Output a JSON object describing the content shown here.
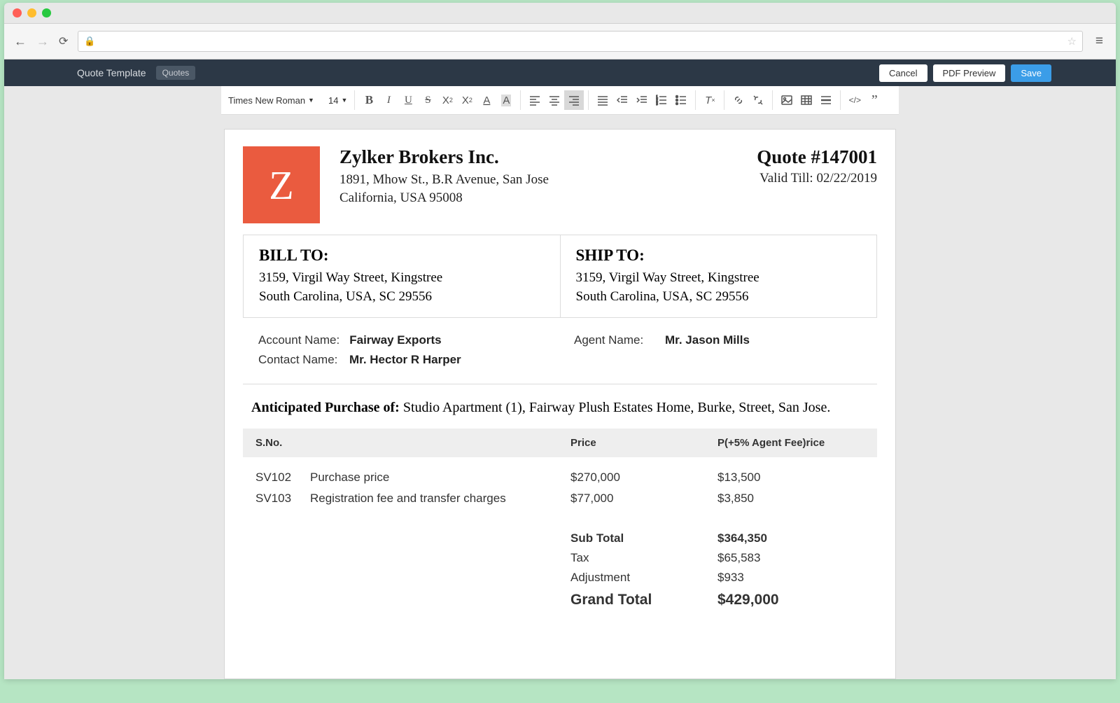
{
  "appBar": {
    "title": "Quote Template",
    "badge": "Quotes",
    "buttons": {
      "cancel": "Cancel",
      "pdf": "PDF Preview",
      "save": "Save"
    }
  },
  "toolbar": {
    "font": "Times New Roman",
    "fontSize": "14"
  },
  "company": {
    "logoLetter": "Z",
    "name": "Zylker Brokers Inc.",
    "addr1": "1891, Mhow St., B.R Avenue, San Jose",
    "addr2": "California, USA 95008"
  },
  "quote": {
    "number": "Quote #147001",
    "validTill": "Valid Till: 02/22/2019"
  },
  "billTo": {
    "title": "BILL TO:",
    "line1": "3159, Virgil Way Street, Kingstree",
    "line2": "South Carolina, USA, SC 29556"
  },
  "shipTo": {
    "title": "SHIP TO:",
    "line1": "3159, Virgil Way Street, Kingstree",
    "line2": "South Carolina, USA, SC 29556"
  },
  "meta": {
    "accountLabel": "Account Name:",
    "accountValue": "Fairway Exports",
    "contactLabel": "Contact Name:",
    "contactValue": "Mr. Hector R Harper",
    "agentLabel": "Agent Name:",
    "agentValue": "Mr. Jason Mills"
  },
  "purchase": {
    "label": "Anticipated Purchase of:",
    "text": "Studio Apartment (1), Fairway Plush Estates Home, Burke, Street, San Jose."
  },
  "table": {
    "headers": {
      "sno": "S.No.",
      "price": "Price",
      "fee": "P(+5% Agent Fee)rice"
    },
    "rows": [
      {
        "sno": "SV102",
        "desc": "Purchase price",
        "price": "$270,000",
        "fee": "$13,500"
      },
      {
        "sno": "SV103",
        "desc": "Registration fee and transfer charges",
        "price": "$77,000",
        "fee": "$3,850"
      }
    ],
    "totals": {
      "subLabel": "Sub Total",
      "subValue": "$364,350",
      "taxLabel": "Tax",
      "taxValue": "$65,583",
      "adjLabel": "Adjustment",
      "adjValue": "$933",
      "grandLabel": "Grand Total",
      "grandValue": "$429,000"
    }
  }
}
